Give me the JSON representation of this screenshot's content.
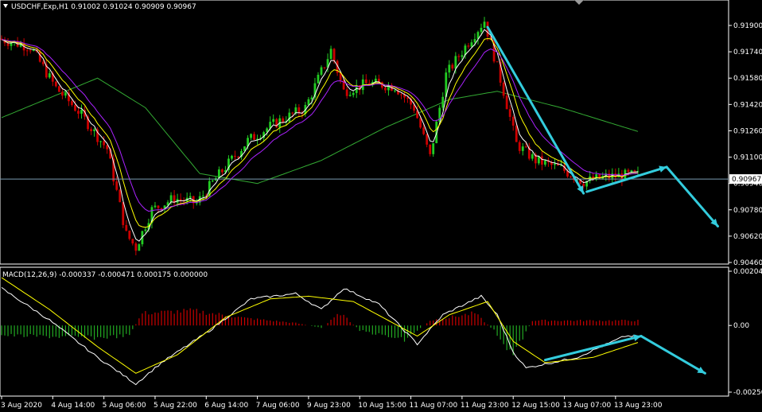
{
  "colors": {
    "background": "#000000",
    "frame": "#ffffff",
    "bull": "#22cc22",
    "bear": "#cc0000",
    "ma_fast": "#ffffff",
    "ma_mid": "#ffff00",
    "ma_slow": "#aa22ff",
    "ma_long": "#33aa33",
    "arrow": "#33ccdd",
    "bid_line": "#7a9ab0",
    "macd_main": "#ffffff",
    "macd_signal": "#ffff00",
    "hist_pos": "#cc0000",
    "hist_neg": "#22aa22"
  },
  "chart_data": [
    {
      "type": "candlestick",
      "title": "USDCHF,Exp,H1  0.91002 0.91024 0.90909 0.90967",
      "symbol_icon": "triangle-down-icon",
      "ylim": [
        0.9046,
        0.9198
      ],
      "y_ticks": [
        "0.91900",
        "0.91740",
        "0.91580",
        "0.91420",
        "0.91260",
        "0.91100",
        "0.90940",
        "0.90780",
        "0.90620",
        "0.90460"
      ],
      "y_tick_values": [
        0.919,
        0.9174,
        0.9158,
        0.9142,
        0.9126,
        0.911,
        0.9094,
        0.9078,
        0.9062,
        0.9046
      ],
      "current_price": 0.90967,
      "current_price_label": "0.90967",
      "x_labels": [
        "3 Aug 2020",
        "4 Aug 14:00",
        "5 Aug 06:00",
        "5 Aug 22:00",
        "6 Aug 14:00",
        "7 Aug 06:00",
        "9 Aug 23:00",
        "10 Aug 15:00",
        "11 Aug 07:00",
        "11 Aug 23:00",
        "12 Aug 15:00",
        "13 Aug 07:00",
        "13 Aug 23:00"
      ],
      "x_label_bars": [
        0,
        16,
        32,
        48,
        64,
        80,
        96,
        112,
        128,
        144,
        160,
        176,
        192
      ],
      "path": [
        [
          0,
          0.9182
        ],
        [
          10,
          0.9177
        ],
        [
          18,
          0.9152
        ],
        [
          25,
          0.9138
        ],
        [
          34,
          0.9115
        ],
        [
          40,
          0.9063
        ],
        [
          43,
          0.9055
        ],
        [
          48,
          0.9078
        ],
        [
          55,
          0.9085
        ],
        [
          62,
          0.9082
        ],
        [
          68,
          0.9097
        ],
        [
          78,
          0.912
        ],
        [
          86,
          0.913
        ],
        [
          96,
          0.914
        ],
        [
          104,
          0.9175
        ],
        [
          108,
          0.915
        ],
        [
          116,
          0.9155
        ],
        [
          124,
          0.9153
        ],
        [
          130,
          0.914
        ],
        [
          135,
          0.911
        ],
        [
          140,
          0.916
        ],
        [
          147,
          0.918
        ],
        [
          152,
          0.9193
        ],
        [
          158,
          0.915
        ],
        [
          162,
          0.9118
        ],
        [
          168,
          0.9108
        ],
        [
          176,
          0.9103
        ],
        [
          183,
          0.9095
        ],
        [
          190,
          0.9098
        ],
        [
          197,
          0.9099
        ]
      ],
      "ma_long": [
        [
          0,
          0.9134
        ],
        [
          30,
          0.9158
        ],
        [
          45,
          0.914
        ],
        [
          62,
          0.91
        ],
        [
          80,
          0.9094
        ],
        [
          100,
          0.9108
        ],
        [
          120,
          0.9128
        ],
        [
          140,
          0.9145
        ],
        [
          155,
          0.915
        ],
        [
          175,
          0.914
        ],
        [
          200,
          0.9125
        ]
      ],
      "arrows": [
        [
          [
            152,
            0.9189
          ],
          [
            182,
            0.9088
          ]
        ],
        [
          [
            183,
            0.9089
          ],
          [
            208,
            0.9104
          ]
        ],
        [
          [
            208,
            0.9104
          ],
          [
            224,
            0.9068
          ]
        ]
      ]
    },
    {
      "type": "line",
      "title": "MACD(12,26,9) -0.000337 -0.000471 0.000175 0.000000",
      "ylim": [
        -0.002508,
        0.002041
      ],
      "y_ticks": [
        "0.002041",
        "0.00",
        "-0.002508"
      ],
      "y_tick_values": [
        0.002041,
        0.0,
        -0.002508
      ],
      "main": [
        [
          0,
          0.0014
        ],
        [
          15,
          0.0002
        ],
        [
          30,
          -0.0012
        ],
        [
          42,
          -0.0022
        ],
        [
          50,
          -0.0014
        ],
        [
          65,
          -0.0002
        ],
        [
          78,
          0.001
        ],
        [
          92,
          0.0012
        ],
        [
          100,
          0.0006
        ],
        [
          107,
          0.0014
        ],
        [
          118,
          0.0008
        ],
        [
          130,
          -0.0007
        ],
        [
          138,
          0.0004
        ],
        [
          150,
          0.0011
        ],
        [
          155,
          0.0004
        ],
        [
          160,
          -0.001
        ],
        [
          164,
          -0.0016
        ],
        [
          180,
          -0.0012
        ],
        [
          195,
          -0.0004
        ],
        [
          200,
          -0.0004
        ]
      ],
      "signal": [
        [
          0,
          0.0018
        ],
        [
          15,
          0.0006
        ],
        [
          30,
          -0.0008
        ],
        [
          42,
          -0.0018
        ],
        [
          55,
          -0.0011
        ],
        [
          70,
          0.0003
        ],
        [
          84,
          0.001
        ],
        [
          96,
          0.0011
        ],
        [
          110,
          0.0009
        ],
        [
          130,
          -0.0004
        ],
        [
          140,
          0.0004
        ],
        [
          152,
          0.0009
        ],
        [
          160,
          -0.0006
        ],
        [
          170,
          -0.0014
        ],
        [
          185,
          -0.0012
        ],
        [
          200,
          -0.0006
        ]
      ],
      "histogram": [
        [
          0,
          -0.0004
        ],
        [
          30,
          -0.0005
        ],
        [
          40,
          -0.0004
        ],
        [
          44,
          0.0005
        ],
        [
          60,
          0.0006
        ],
        [
          76,
          0.0003
        ],
        [
          92,
          0.0001
        ],
        [
          100,
          -0.0001
        ],
        [
          106,
          0.0005
        ],
        [
          112,
          -0.0002
        ],
        [
          126,
          -0.0006
        ],
        [
          134,
          0.0002
        ],
        [
          148,
          0.0005
        ],
        [
          154,
          -0.0002
        ],
        [
          160,
          -0.0012
        ],
        [
          166,
          0.0002
        ],
        [
          200,
          0.0002
        ]
      ],
      "arrows": [
        [
          [
            170,
            -0.0013
          ],
          [
            200,
            -0.0004
          ]
        ],
        [
          [
            200,
            -0.0004
          ],
          [
            220,
            -0.0018
          ]
        ]
      ]
    }
  ]
}
